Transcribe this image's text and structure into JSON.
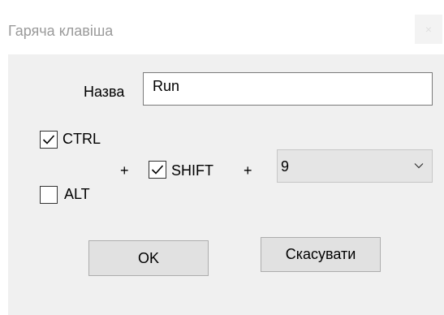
{
  "window": {
    "title": "Гаряча клавіша",
    "close_glyph": "×"
  },
  "form": {
    "name_label": "Назва",
    "name_value": "Run",
    "ctrl": {
      "label": "CTRL",
      "checked": true
    },
    "alt": {
      "label": "ALT",
      "checked": false
    },
    "shift": {
      "label": "SHIFT",
      "checked": true
    },
    "plus_sign": "+",
    "key_select": {
      "value": "9"
    }
  },
  "buttons": {
    "ok_label": "OK",
    "cancel_label": "Скасувати"
  },
  "icons": {
    "checkmark": "checkmark-icon",
    "dropdown": "chevron-down-icon",
    "close": "close-icon"
  },
  "colors": {
    "client_bg": "#f0f0f0",
    "button_bg": "#e1e1e1",
    "title_text": "#9a9a9a"
  }
}
